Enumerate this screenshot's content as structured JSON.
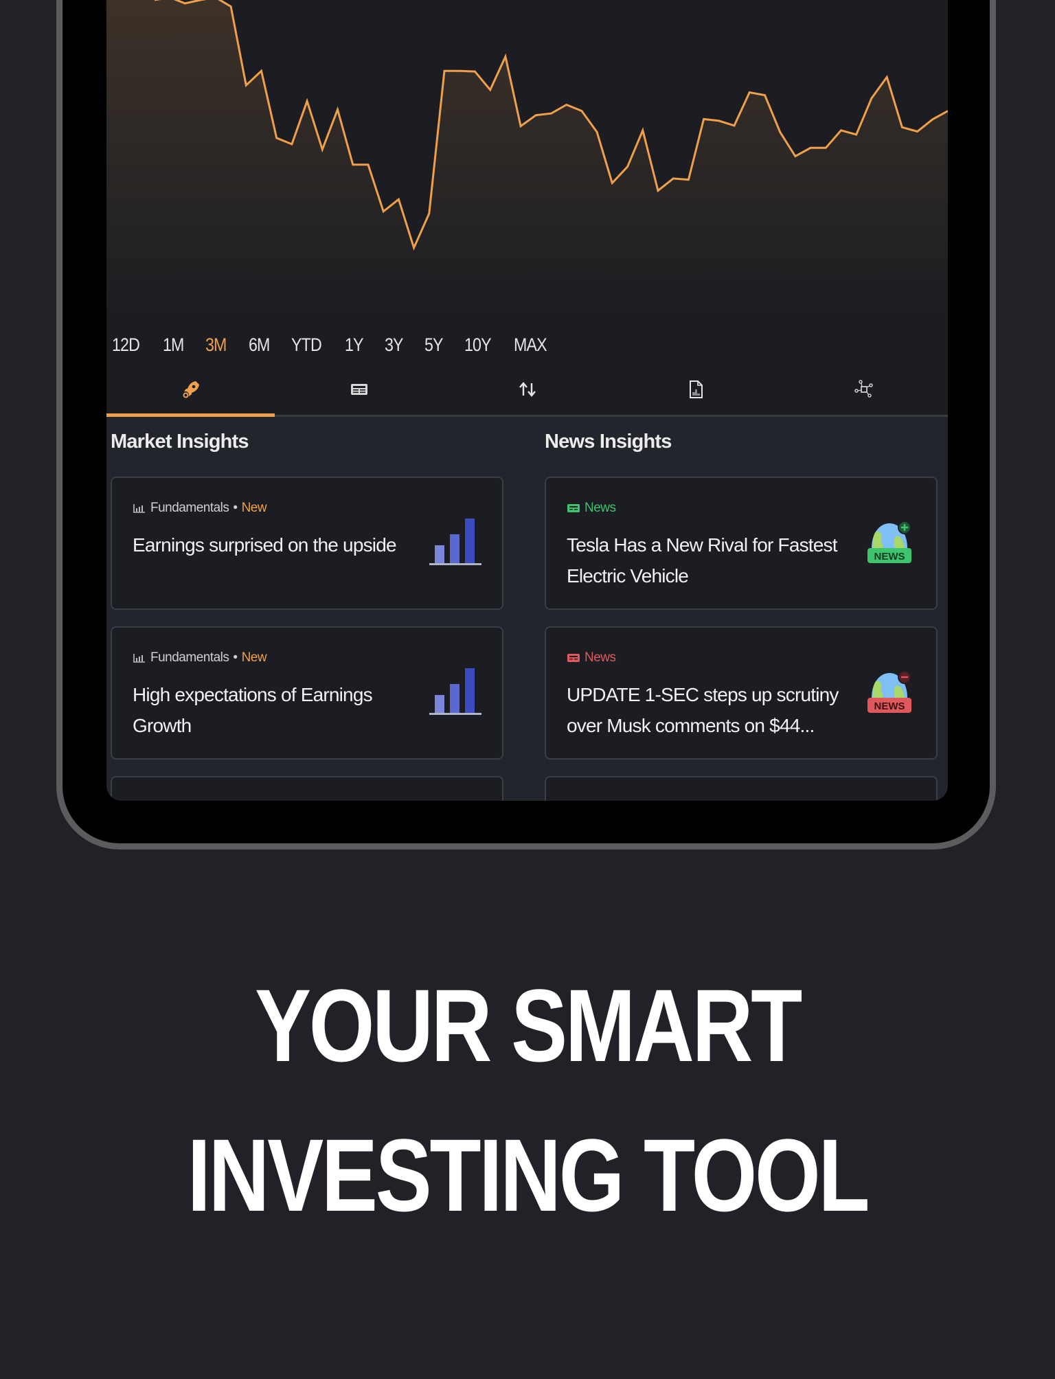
{
  "chart": {
    "type": "line",
    "color": "#f0a04a",
    "selected_range": "3M",
    "series": [
      {
        "name": "price",
        "values": [
          100.0,
          100.9,
          98.8,
          100.0,
          100.9,
          97.7,
          69.7,
          74.8,
          51.0,
          48.8,
          64.1,
          46.9,
          61.1,
          41.5,
          41.5,
          24.9,
          29.2,
          12.0,
          24.2,
          74.8,
          74.8,
          74.6,
          68.1,
          79.9,
          55.2,
          59.1,
          59.7,
          62.8,
          60.6,
          53.1,
          35.0,
          40.8,
          53.7,
          32.3,
          36.6,
          36.2,
          57.7,
          57.1,
          55.4,
          67.2,
          66.2,
          53.1,
          44.5,
          47.5,
          47.5,
          53.7,
          52.2,
          65.1,
          72.6,
          54.8,
          53.3,
          57.6,
          60.6
        ]
      }
    ]
  },
  "ranges": [
    "12D",
    "1M",
    "3M",
    "6M",
    "YTD",
    "1Y",
    "3Y",
    "5Y",
    "10Y",
    "MAX"
  ],
  "tabs": [
    {
      "icon": "rocket-icon",
      "active": true
    },
    {
      "icon": "newspaper-icon",
      "active": false
    },
    {
      "icon": "up-down-arrows-icon",
      "active": false
    },
    {
      "icon": "document-chart-icon",
      "active": false
    },
    {
      "icon": "network-icon",
      "active": false
    }
  ],
  "market_insights": {
    "title": "Market Insights",
    "cards": [
      {
        "category": "Fundamentals",
        "separator": "•",
        "badge": "New",
        "title": "Earnings surprised on the upside",
        "icon": "bar-chart-icon"
      },
      {
        "category": "Fundamentals",
        "separator": "•",
        "badge": "New",
        "title": "High expectations of Earnings Growth",
        "icon": "bar-chart-icon"
      }
    ]
  },
  "news_insights": {
    "title": "News Insights",
    "cards": [
      {
        "category": "News",
        "sentiment": "positive",
        "color": "#3ec46d",
        "title": "Tesla Has a New Rival for Fastest Electric Vehicle",
        "icon": "news-globe-positive-icon",
        "badge_text": "NEWS"
      },
      {
        "category": "News",
        "sentiment": "negative",
        "color": "#e0585c",
        "title": "UPDATE 1-SEC steps up scrutiny over Musk comments on $44...",
        "icon": "news-globe-negative-icon",
        "badge_text": "NEWS"
      }
    ]
  },
  "headline": {
    "line1": "YOUR SMART",
    "line2": "INVESTING TOOL"
  },
  "colors": {
    "accent": "#f0a04a",
    "background": "#202227",
    "positive": "#3ec46d",
    "negative": "#e0585c",
    "bar_chart": [
      "#7b86d8",
      "#5a68d0",
      "#3c4bc0"
    ]
  }
}
